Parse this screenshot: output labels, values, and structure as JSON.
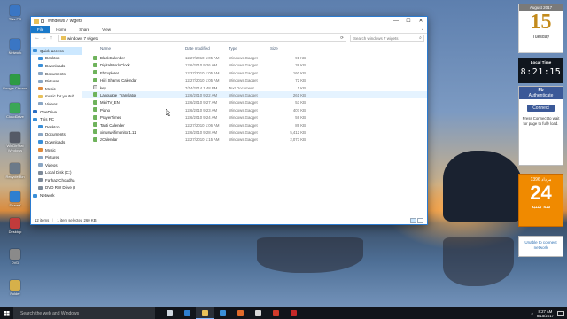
{
  "desktop": {
    "icons": [
      {
        "label": "This PC",
        "color": "#3a76c4"
      },
      {
        "label": "Network",
        "color": "#3a76c4"
      },
      {
        "label": "Google Chrome",
        "color": "#2e9b45"
      },
      {
        "label": "CloudDrive",
        "color": "#3aa757"
      },
      {
        "label": "WinDirStat Windows",
        "color": "#555a66"
      },
      {
        "label": "Recycle Bin",
        "color": "#6c7a89"
      },
      {
        "label": "ShareX",
        "color": "#2f7fd0"
      },
      {
        "label": "Desktop",
        "color": "#c23b3b"
      },
      {
        "label": "DVD",
        "color": "#8a8a8a"
      },
      {
        "label": "Folder",
        "color": "#d6b04a"
      }
    ]
  },
  "explorer": {
    "title": "windows 7 wigets",
    "window_buttons": {
      "minimize": "—",
      "maximize": "☐",
      "close": "✕"
    },
    "ribbon_tabs": [
      "File",
      "Home",
      "Share",
      "View"
    ],
    "nav_buttons": {
      "back": "←",
      "forward": "→",
      "up": "↑"
    },
    "address": "windows 7 wigets",
    "search_placeholder": "Search windows 7 wigets",
    "nav_pane": [
      {
        "label": "Quick access",
        "color": "#3a8fd8",
        "selected": true
      },
      {
        "label": "Desktop",
        "color": "#3a8fd8"
      },
      {
        "label": "Downloads",
        "color": "#3a8fd8"
      },
      {
        "label": "Documents",
        "color": "#8aa6c4"
      },
      {
        "label": "Pictures",
        "color": "#8aa6c4"
      },
      {
        "label": "Music",
        "color": "#e08a3a"
      },
      {
        "label": "music for youtub",
        "color": "#e8c15a"
      },
      {
        "label": "Videos",
        "color": "#8aa6c4"
      },
      {
        "label": "OneDrive",
        "color": "#2a6fc4"
      },
      {
        "label": "This PC",
        "color": "#3a8fd8"
      },
      {
        "label": "Desktop",
        "color": "#3a8fd8"
      },
      {
        "label": "Documents",
        "color": "#8aa6c4"
      },
      {
        "label": "Downloads",
        "color": "#3a8fd8"
      },
      {
        "label": "Music",
        "color": "#e08a3a"
      },
      {
        "label": "Pictures",
        "color": "#8aa6c4"
      },
      {
        "label": "Videos",
        "color": "#8aa6c4"
      },
      {
        "label": "Local Disk (C:)",
        "color": "#7d8a99"
      },
      {
        "label": "Farhaz Choudha",
        "color": "#7d8a99"
      },
      {
        "label": "DVD RW Drive (I",
        "color": "#7d8a99"
      },
      {
        "label": "Network",
        "color": "#3a8fd8"
      }
    ],
    "columns": {
      "name": "Name",
      "date": "Date modified",
      "type": "Type",
      "size": "Size"
    },
    "files": [
      {
        "name": "BlackCalender",
        "date": "12/27/2010 1:05 AM",
        "type": "Windows Gadget",
        "size": "91 KB",
        "kind": "gadget"
      },
      {
        "name": "DigitalWorldClock",
        "date": "12/6/2010 9:26 AM",
        "type": "Windows Gadget",
        "size": "38 KB",
        "kind": "gadget"
      },
      {
        "name": "FbExplorer",
        "date": "12/27/2010 1:05 AM",
        "type": "Windows Gadget",
        "size": "160 KB",
        "kind": "gadget"
      },
      {
        "name": "Hijri Shamsi Calendar",
        "date": "12/27/2010 1:05 AM",
        "type": "Windows Gadget",
        "size": "72 KB",
        "kind": "gadget"
      },
      {
        "name": "key",
        "date": "7/14/2014 1:48 PM",
        "type": "Text Document",
        "size": "1 KB",
        "kind": "text"
      },
      {
        "name": "Language_Translator",
        "date": "12/6/2010 9:22 AM",
        "type": "Windows Gadget",
        "size": "261 KB",
        "kind": "gadget",
        "hover": true
      },
      {
        "name": "MiniTV_EN",
        "date": "12/6/2010 9:27 AM",
        "type": "Windows Gadget",
        "size": "53 KB",
        "kind": "gadget"
      },
      {
        "name": "Piano",
        "date": "12/6/2010 9:23 AM",
        "type": "Windows Gadget",
        "size": "407 KB",
        "kind": "gadget"
      },
      {
        "name": "PrayerTimes",
        "date": "12/6/2010 9:24 AM",
        "type": "Windows Gadget",
        "size": "59 KB",
        "kind": "gadget"
      },
      {
        "name": "Tanti Calender",
        "date": "12/27/2010 1:06 AM",
        "type": "Windows Gadget",
        "size": "89 KB",
        "kind": "gadget"
      },
      {
        "name": "xirrusw-ifimonitor1.11",
        "date": "12/6/2010 9:28 AM",
        "type": "Windows Gadget",
        "size": "5,412 KB",
        "kind": "gadget"
      },
      {
        "name": "zCalendar",
        "date": "12/27/2010 1:15 AM",
        "type": "Windows Gadget",
        "size": "2,073 KB",
        "kind": "gadget"
      }
    ],
    "status": {
      "items": "12 items",
      "selected": "1 item selected  260 KB"
    }
  },
  "gadgets": {
    "calendar": {
      "month": "August 2017",
      "day": "15",
      "weekday": "Tuesday"
    },
    "clock": {
      "label": "Local Time",
      "time": "8:21:15"
    },
    "facebook": {
      "brand": "Fb",
      "title": "Authenticate",
      "button": "Connect",
      "hint": "Press Connect to wait for page to fully load."
    },
    "shamsi": {
      "month": "مرداد 1396",
      "day": "24",
      "weekday": "سه شنبه"
    },
    "network": {
      "text": "Unable to connect network"
    }
  },
  "taskbar": {
    "search_placeholder": "Search the web and Windows",
    "apps": [
      {
        "name": "task-view",
        "color": "#cfd6df"
      },
      {
        "name": "edge",
        "color": "#2f7fd0"
      },
      {
        "name": "explorer",
        "color": "#e8c15a",
        "active": true
      },
      {
        "name": "store",
        "color": "#3a8fd8"
      },
      {
        "name": "photos",
        "color": "#e06a2a"
      },
      {
        "name": "media",
        "color": "#d8d8d8"
      },
      {
        "name": "opera",
        "color": "#d23a2a"
      },
      {
        "name": "recorder",
        "color": "#c62828"
      }
    ],
    "tray_arrow": "˄",
    "time": "8:27 AM",
    "date": "8/15/2017"
  }
}
